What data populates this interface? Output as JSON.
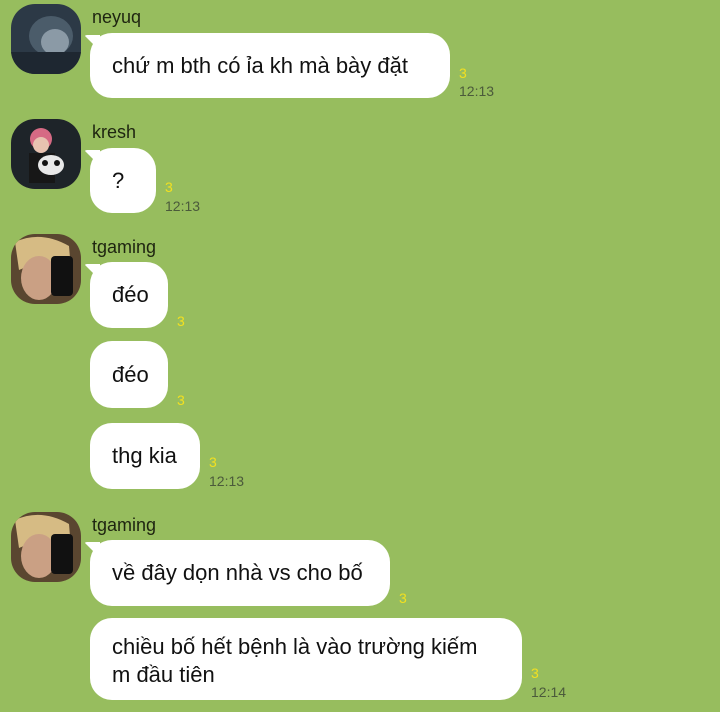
{
  "colors": {
    "background": "#97bd5e",
    "bubble": "#ffffff",
    "read_count": "#f2e020",
    "timestamp": "#4b5a3b"
  },
  "messages": [
    {
      "sender": "neyuq",
      "text": "chứ m bth có ỉa kh mà bày đặt",
      "read": "3",
      "time": "12:13"
    },
    {
      "sender": "kresh",
      "text": "?",
      "read": "3",
      "time": "12:13"
    },
    {
      "sender": "tgaming",
      "text": "đéo",
      "read": "3"
    },
    {
      "text": "đéo",
      "read": "3"
    },
    {
      "text": "thg kia",
      "read": "3",
      "time": "12:13"
    },
    {
      "sender": "tgaming",
      "text": "về đây dọn nhà vs cho bố",
      "read": "3"
    },
    {
      "text": "chiều bố hết bệnh là vào trường kiếm m đầu tiên",
      "read": "3",
      "time": "12:14"
    }
  ]
}
